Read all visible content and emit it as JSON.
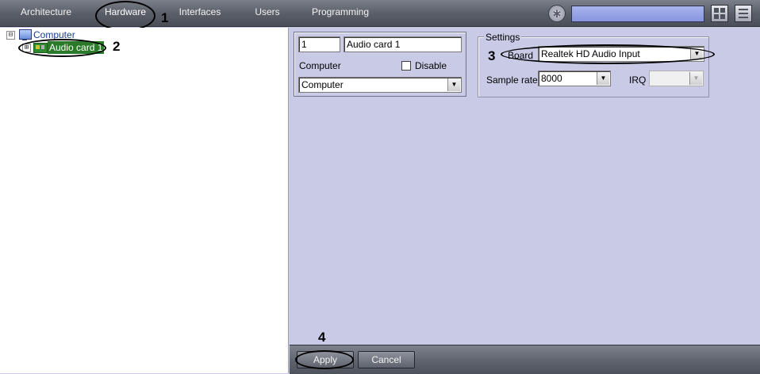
{
  "top_tabs": [
    "Architecture",
    "Hardware",
    "Interfaces",
    "Users",
    "Programming"
  ],
  "active_tab": "Hardware",
  "toolbar": {
    "search_value": "",
    "icons": [
      "gear-icon",
      "layout-grid-icon",
      "menu-icon"
    ]
  },
  "tree": {
    "root": {
      "label": "Computer",
      "expander": "⊟",
      "icon": "monitor-icon"
    },
    "child": {
      "label": "Audio card 1",
      "expander": "⊞",
      "icon": "audio-card-icon"
    }
  },
  "object": {
    "id": "1",
    "name": "Audio card 1",
    "computer_label": "Computer",
    "disable_label": "Disable",
    "disable_checked": false,
    "computer_value": "Computer"
  },
  "settings": {
    "legend": "Settings",
    "board_label": "Board",
    "board_value": "Realtek HD Audio Input",
    "sample_rate_label": "Sample rate",
    "sample_rate_value": "8000",
    "irq_label": "IRQ",
    "irq_value": ""
  },
  "buttons": {
    "apply": "Apply",
    "cancel": "Cancel"
  },
  "callouts": [
    "1",
    "2",
    "3",
    "4"
  ]
}
